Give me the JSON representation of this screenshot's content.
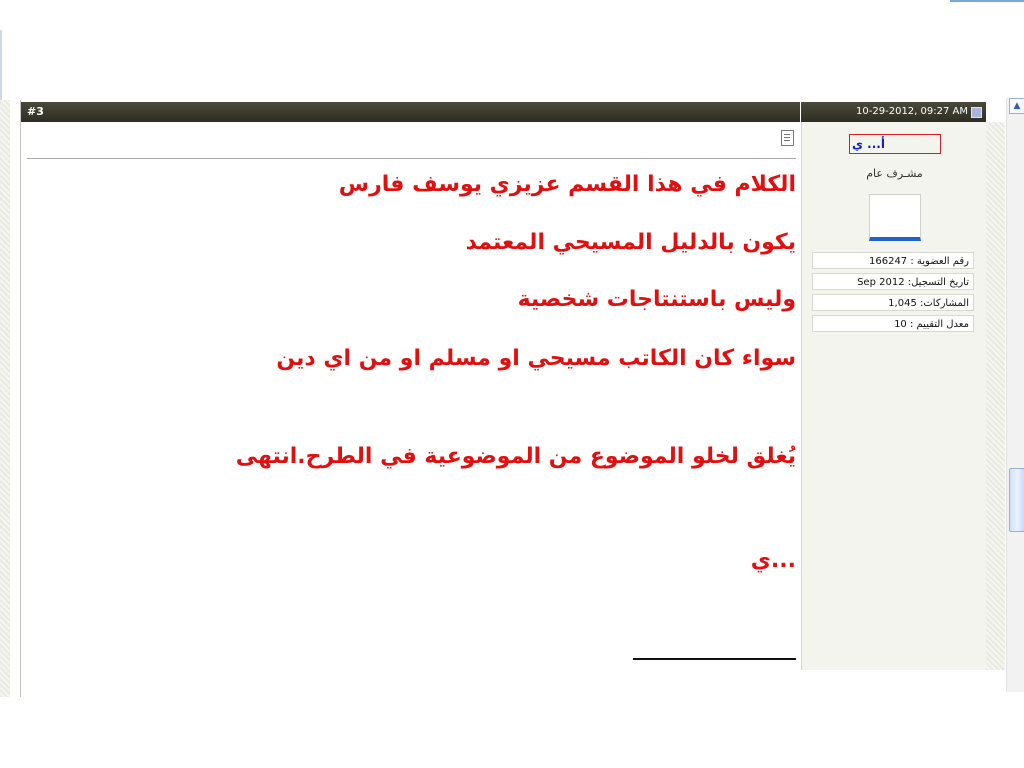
{
  "post": {
    "number": "#3",
    "date": "10-29-2012, 09:27 AM",
    "lines": [
      "الكلام في هذا القسم عزيزي يوسف فارس",
      "يكون بالدليل المسيحي المعتمد",
      "وليس باستنتاجات شخصية",
      "سواء كان الكاتب مسيحي او مسلم او من اي دين",
      "يُغلق لخلو الموضوع من الموضوعية في الطرح.انتهى",
      "...ي"
    ]
  },
  "user": {
    "name": "أ... ي",
    "title": "مشـرف عام",
    "member_id": "رقم العضوية : 166247",
    "join_date": "تاريخ التسجيل: Sep 2012",
    "posts": "المشاركات: 1,045",
    "rating": "معدل التقييم : 10"
  },
  "colors": {
    "post_text": "#e01010",
    "header_bg": "#2d2d22",
    "username": "#1020c0"
  },
  "icons": {
    "post": "document-icon",
    "date": "post-status-icon",
    "scroll": "chevron-up-icon"
  }
}
